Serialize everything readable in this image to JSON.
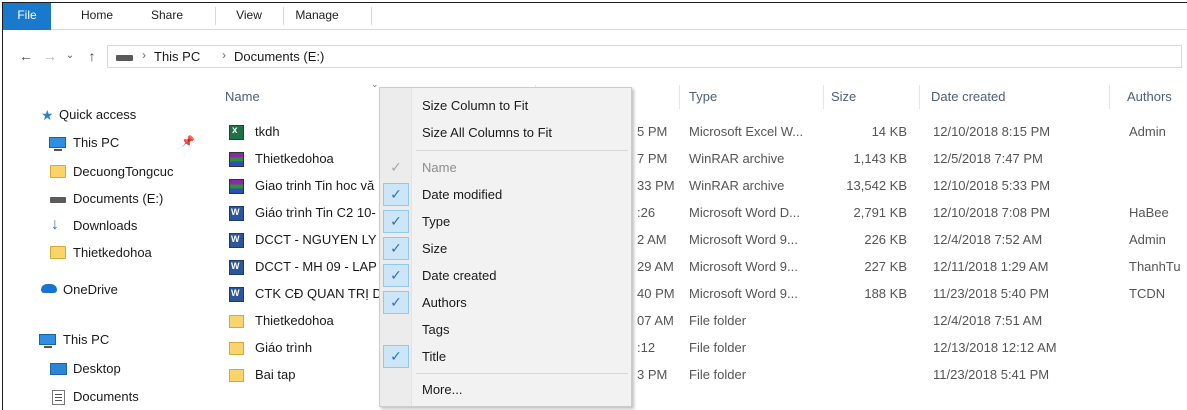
{
  "ribbon": {
    "tabs": [
      {
        "label": "File"
      },
      {
        "label": "Home"
      },
      {
        "label": "Share"
      },
      {
        "label": "View"
      },
      {
        "label": "Manage"
      }
    ]
  },
  "address": {
    "crumbs": [
      "This PC",
      "Documents (E:)"
    ]
  },
  "navpane": {
    "items": [
      {
        "label": "Quick access",
        "icon": "star-icon"
      },
      {
        "label": "This PC",
        "icon": "pc-icon"
      },
      {
        "label": "DecuongTongcuc",
        "icon": "folder-icon"
      },
      {
        "label": "Documents (E:)",
        "icon": "drive-icon"
      },
      {
        "label": "Downloads",
        "icon": "download-icon"
      },
      {
        "label": "Thietkedohoa",
        "icon": "folder-icon"
      },
      {
        "label": "OneDrive",
        "icon": "cloud-icon"
      },
      {
        "label": "This PC",
        "icon": "pc-icon"
      },
      {
        "label": "Desktop",
        "icon": "desktop-icon"
      },
      {
        "label": "Documents",
        "icon": "documents-icon"
      }
    ]
  },
  "columns": {
    "name": "Name",
    "type": "Type",
    "size": "Size",
    "date_created": "Date created",
    "authors": "Authors"
  },
  "files": [
    {
      "name": "tkdh",
      "icon": "excel-icon",
      "date_modified_fragment": "5 PM",
      "type": "Microsoft Excel W...",
      "size": "14 KB",
      "date_created": "12/10/2018 8:15 PM",
      "authors": "Admin"
    },
    {
      "name": "Thietkedohoa",
      "icon": "winrar-icon",
      "date_modified_fragment": "7 PM",
      "type": "WinRAR archive",
      "size": "1,143 KB",
      "date_created": "12/5/2018 7:47 PM",
      "authors": ""
    },
    {
      "name": "Giao trinh Tin hoc vă",
      "icon": "winrar-icon",
      "date_modified_fragment": "33 PM",
      "type": "WinRAR archive",
      "size": "13,542 KB",
      "date_created": "12/10/2018 5:33 PM",
      "authors": ""
    },
    {
      "name": "Giáo trình Tin C2 10-",
      "icon": "word-icon",
      "date_modified_fragment": ":26",
      "type": "Microsoft Word D...",
      "size": "2,791 KB",
      "date_created": "12/10/2018 7:08 PM",
      "authors": "HaBee"
    },
    {
      "name": "DCCT - NGUYEN LY",
      "icon": "word-icon",
      "date_modified_fragment": "2 AM",
      "type": "Microsoft Word 9...",
      "size": "226 KB",
      "date_created": "12/4/2018 7:52 AM",
      "authors": "Admin"
    },
    {
      "name": "DCCT - MH 09 - LAP",
      "icon": "word-icon",
      "date_modified_fragment": "29 AM",
      "type": "Microsoft Word 9...",
      "size": "227 KB",
      "date_created": "12/11/2018 1:29 AM",
      "authors": "ThanhTu"
    },
    {
      "name": "CTK CĐ QUAN TRỊ D",
      "icon": "word-icon",
      "date_modified_fragment": "40 PM",
      "type": "Microsoft Word 9...",
      "size": "188 KB",
      "date_created": "11/23/2018 5:40 PM",
      "authors": "TCDN"
    },
    {
      "name": "Thietkedohoa",
      "icon": "folder-icon",
      "date_modified_fragment": "07 AM",
      "type": "File folder",
      "size": "",
      "date_created": "12/4/2018 7:51 AM",
      "authors": ""
    },
    {
      "name": "Giáo trình",
      "icon": "folder-icon",
      "date_modified_fragment": ":12",
      "type": "File folder",
      "size": "",
      "date_created": "12/13/2018 12:12 AM",
      "authors": ""
    },
    {
      "name": "Bai tap",
      "icon": "folder-icon",
      "date_modified_fragment": "3 PM",
      "type": "File folder",
      "size": "",
      "date_created": "11/23/2018 5:41 PM",
      "authors": ""
    }
  ],
  "context_menu": {
    "size_column": "Size Column to Fit",
    "size_all": "Size All Columns to Fit",
    "columns": [
      {
        "label": "Name",
        "checked": true,
        "disabled": true
      },
      {
        "label": "Date modified",
        "checked": true,
        "disabled": false
      },
      {
        "label": "Type",
        "checked": true,
        "disabled": false
      },
      {
        "label": "Size",
        "checked": true,
        "disabled": false
      },
      {
        "label": "Date created",
        "checked": true,
        "disabled": false
      },
      {
        "label": "Authors",
        "checked": true,
        "disabled": false
      },
      {
        "label": "Tags",
        "checked": false,
        "disabled": false
      },
      {
        "label": "Title",
        "checked": true,
        "disabled": false
      }
    ],
    "more": "More...",
    "check_glyph": "✓"
  },
  "colors": {
    "file_tab": "#1979ca",
    "check_bg": "#cde6f7",
    "header_text": "#4c607a"
  }
}
